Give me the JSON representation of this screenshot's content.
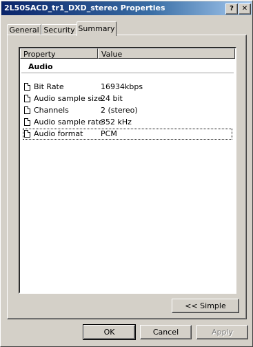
{
  "window": {
    "title": "2L50SACD_tr1_DXD_stereo Properties",
    "help_glyph": "?",
    "close_glyph": "✕"
  },
  "tabs": [
    {
      "label": "General",
      "selected": false
    },
    {
      "label": "Security",
      "selected": false
    },
    {
      "label": "Summary",
      "selected": true
    }
  ],
  "list": {
    "headers": {
      "property": "Property",
      "value": "Value"
    },
    "group": "Audio",
    "rows": [
      {
        "name": "Bit Rate",
        "value": "16934kbps",
        "icon": "document-icon"
      },
      {
        "name": "Audio sample size",
        "value": "24 bit",
        "icon": "document-icon"
      },
      {
        "name": "Channels",
        "value": "2 (stereo)",
        "icon": "document-icon"
      },
      {
        "name": "Audio sample rate",
        "value": "352 kHz",
        "icon": "document-icon"
      },
      {
        "name": "Audio format",
        "value": "PCM",
        "icon": "document-icon",
        "focused": true
      }
    ]
  },
  "buttons": {
    "simple": "<< Simple",
    "ok": "OK",
    "cancel": "Cancel",
    "apply": "Apply"
  }
}
